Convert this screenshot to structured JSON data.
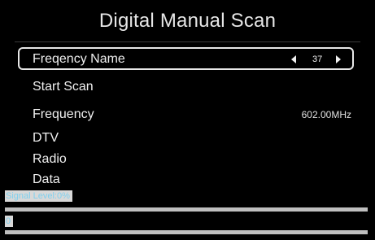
{
  "title": "Digital Manual Scan",
  "menu": {
    "freq_name_label": "Freqency Name",
    "freq_name_value": "37",
    "start_scan_label": "Start Scan",
    "frequency_label": "Frequency",
    "frequency_value": "602.00MHz",
    "dtv_label": "DTV",
    "radio_label": "Radio",
    "data_label": "Data"
  },
  "signal": {
    "level_label": "Signal Level:0%",
    "level_percent": 0,
    "quality_label": "0",
    "quality_percent": 0
  },
  "colors": {
    "background": "#000000",
    "text": "#f0f0f0",
    "focus_border": "#e8e8e8",
    "bar": "#bfbfbf",
    "signal_text": "#7fd0ee"
  },
  "icons": [
    "arrow-left-icon",
    "arrow-right-icon"
  ]
}
